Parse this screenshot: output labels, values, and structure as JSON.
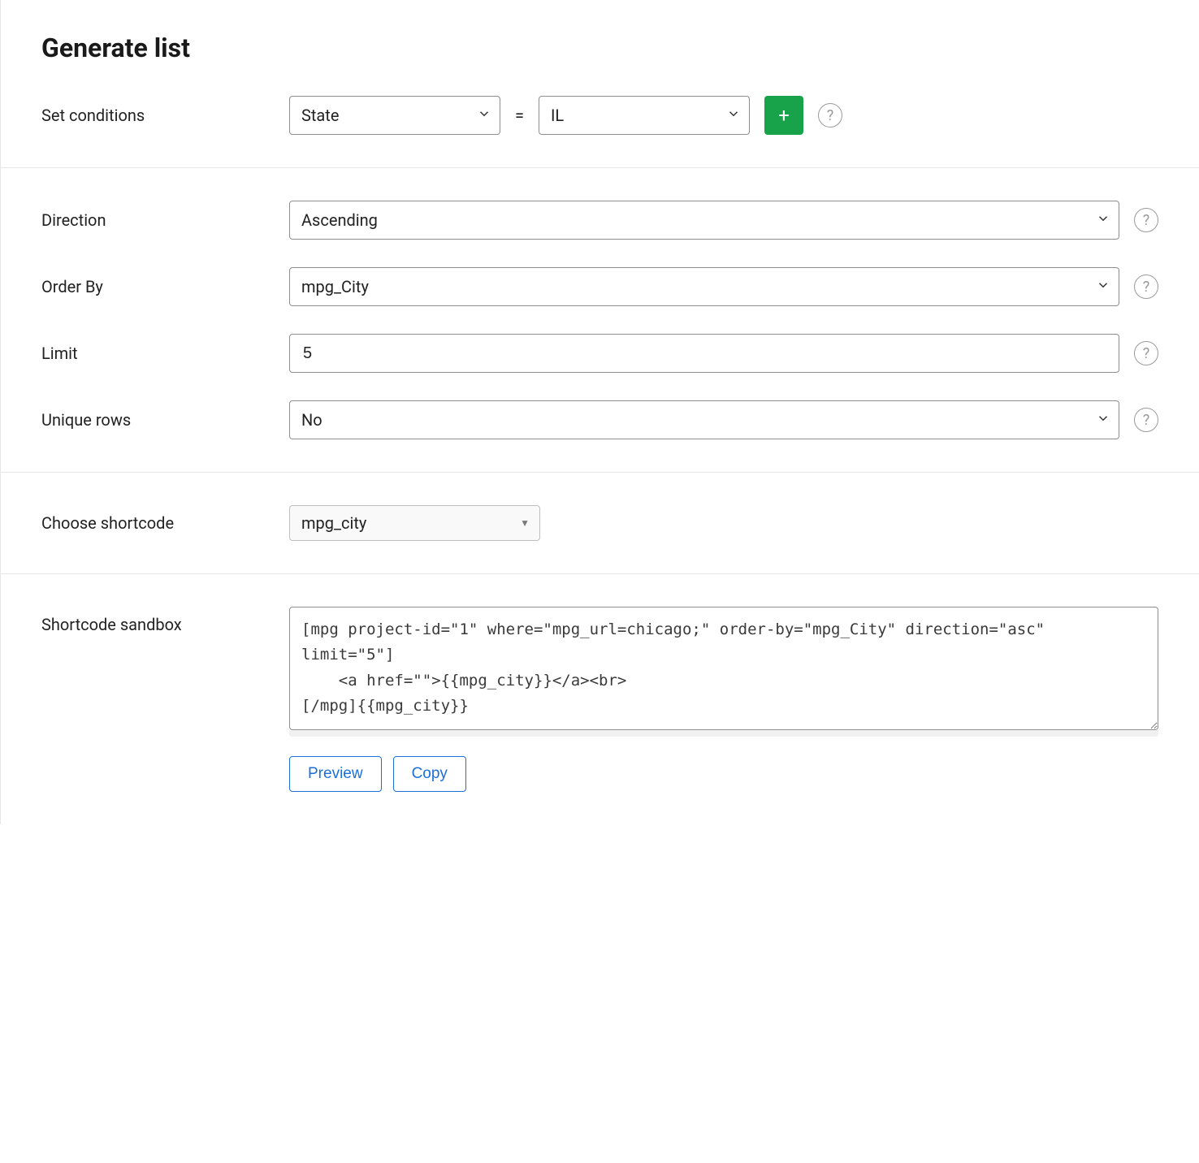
{
  "title": "Generate list",
  "conditions": {
    "label": "Set conditions",
    "field": "State",
    "operator": "=",
    "value": "IL",
    "add": "+"
  },
  "direction": {
    "label": "Direction",
    "value": "Ascending"
  },
  "orderBy": {
    "label": "Order By",
    "value": "mpg_City"
  },
  "limit": {
    "label": "Limit",
    "value": "5"
  },
  "uniqueRows": {
    "label": "Unique rows",
    "value": "No"
  },
  "shortcode": {
    "label": "Choose shortcode",
    "value": "mpg_city"
  },
  "sandbox": {
    "label": "Shortcode sandbox",
    "text": "[mpg project-id=\"1\" where=\"mpg_url=chicago;\" order-by=\"mpg_City\" direction=\"asc\" limit=\"5\"]\n    <a href=\"\">{{mpg_city}}</a><br>\n[/mpg]{{mpg_city}}",
    "preview": "Preview",
    "copy": "Copy"
  },
  "helpGlyph": "?"
}
